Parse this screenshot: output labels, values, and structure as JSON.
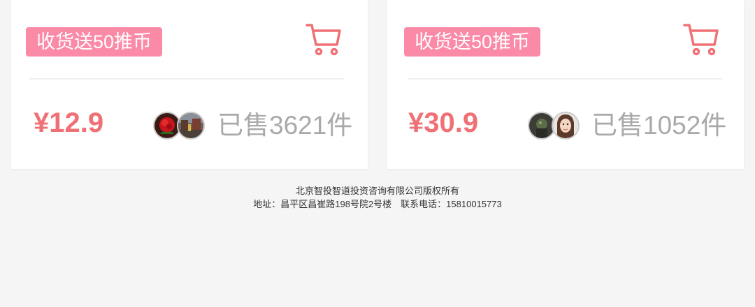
{
  "products": [
    {
      "badge": "收货送50推币",
      "price": "¥12.9",
      "sold": "已售3621件",
      "cart_icon": "shopping-cart-icon",
      "avatars": [
        "rose-avatar",
        "street-avatar"
      ]
    },
    {
      "badge": "收货送50推币",
      "price": "¥30.9",
      "sold": "已售1052件",
      "cart_icon": "shopping-cart-icon",
      "avatars": [
        "dark-avatar",
        "girl-avatar"
      ]
    }
  ],
  "footer": {
    "copyright": "北京智投智道投资咨询有限公司版权所有",
    "address": "地址：昌平区昌崔路198号院2号楼　联系电话：15810015773"
  },
  "colors": {
    "badge_bg": "#fb8aa6",
    "price": "#ef7176",
    "cart": "#ef7176",
    "sold_text": "#a9a9a9",
    "background": "#f5f5f5"
  }
}
